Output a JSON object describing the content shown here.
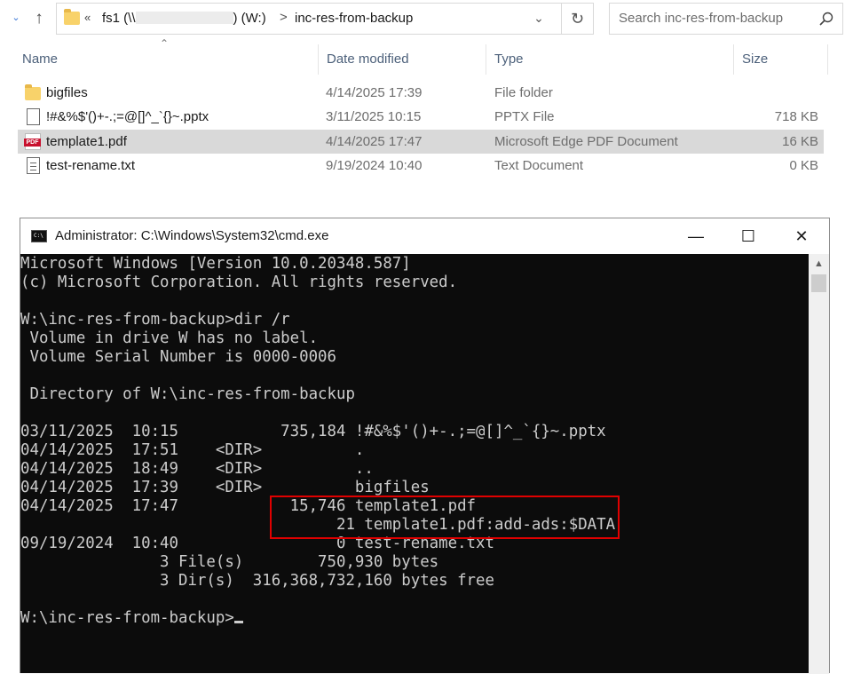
{
  "explorer": {
    "address": {
      "chevron": "«",
      "crumbs": [
        {
          "prefix": "fs1 (\\\\",
          "suffix": ") (W:)"
        },
        {
          "label": "inc-res-from-backup"
        }
      ],
      "separator": ">"
    },
    "search": {
      "placeholder": "Search inc-res-from-backup"
    },
    "columns": {
      "name": "Name",
      "date": "Date modified",
      "type": "Type",
      "size": "Size"
    },
    "files": [
      {
        "name": "bigfiles",
        "date": "4/14/2025 17:39",
        "type": "File folder",
        "size": "",
        "icon": "folder-icon"
      },
      {
        "name": "!#&%$'()+-.;=@[]^_`{}~.pptx",
        "date": "3/11/2025 10:15",
        "type": "PPTX File",
        "size": "718 KB",
        "icon": "document-icon"
      },
      {
        "name": "template1.pdf",
        "date": "4/14/2025 17:47",
        "type": "Microsoft Edge PDF Document",
        "size": "16 KB",
        "icon": "pdf-icon",
        "selected": true
      },
      {
        "name": "test-rename.txt",
        "date": "9/19/2024 10:40",
        "type": "Text Document",
        "size": "0 KB",
        "icon": "text-file-icon"
      }
    ]
  },
  "cmd": {
    "title": "Administrator: C:\\Windows\\System32\\cmd.exe",
    "buttons": {
      "minimize": "—",
      "maximize": "☐",
      "close": "✕"
    },
    "lines": [
      "Microsoft Windows [Version 10.0.20348.587]",
      "(c) Microsoft Corporation. All rights reserved.",
      "",
      "W:\\inc-res-from-backup>dir /r",
      " Volume in drive W has no label.",
      " Volume Serial Number is 0000-0006",
      "",
      " Directory of W:\\inc-res-from-backup",
      "",
      "03/11/2025  10:15           735,184 !#&%$'()+-.;=@[]^_`{}~.pptx",
      "04/14/2025  17:51    <DIR>          .",
      "04/14/2025  18:49    <DIR>          ..",
      "04/14/2025  17:39    <DIR>          bigfiles",
      "04/14/2025  17:47            15,746 template1.pdf",
      "                                  21 template1.pdf:add-ads:$DATA",
      "09/19/2024  10:40                 0 test-rename.txt",
      "               3 File(s)        750,930 bytes",
      "               3 Dir(s)  316,368,732,160 bytes free",
      "",
      "W:\\inc-res-from-backup>"
    ]
  },
  "colors": {
    "console_bg": "#0c0c0c",
    "console_fg": "#cccccc",
    "highlight": "#e00000",
    "selected_row": "#d9d9d9"
  }
}
